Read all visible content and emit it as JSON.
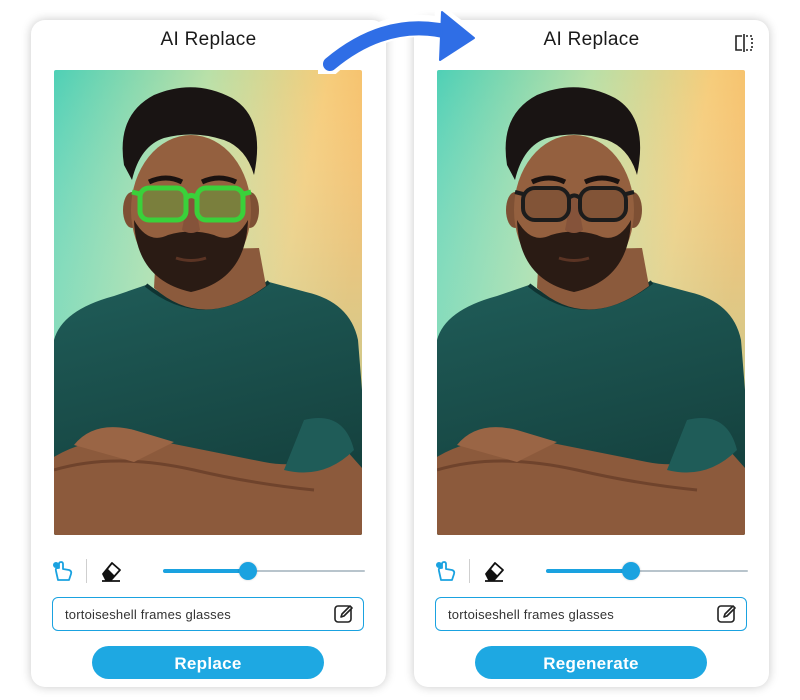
{
  "left_panel": {
    "title": "AI Replace",
    "prompt_text": "tortoiseshell frames glasses",
    "button_label": "Replace",
    "brush_size": 0.42
  },
  "right_panel": {
    "title": "AI Replace",
    "prompt_text": "tortoiseshell frames glasses",
    "button_label": "Regenerate",
    "brush_size": 0.42
  },
  "icons": {
    "brush": "hand-brush-icon",
    "eraser": "eraser-icon",
    "edit": "edit-pencil-icon",
    "compare": "compare-split-icon",
    "arrow": "curved-arrow-icon"
  },
  "colors": {
    "accent": "#1aa2e0",
    "button": "#1ea8e2",
    "selection_mask": "#3ad13a",
    "glasses": "#1c1c1c"
  }
}
